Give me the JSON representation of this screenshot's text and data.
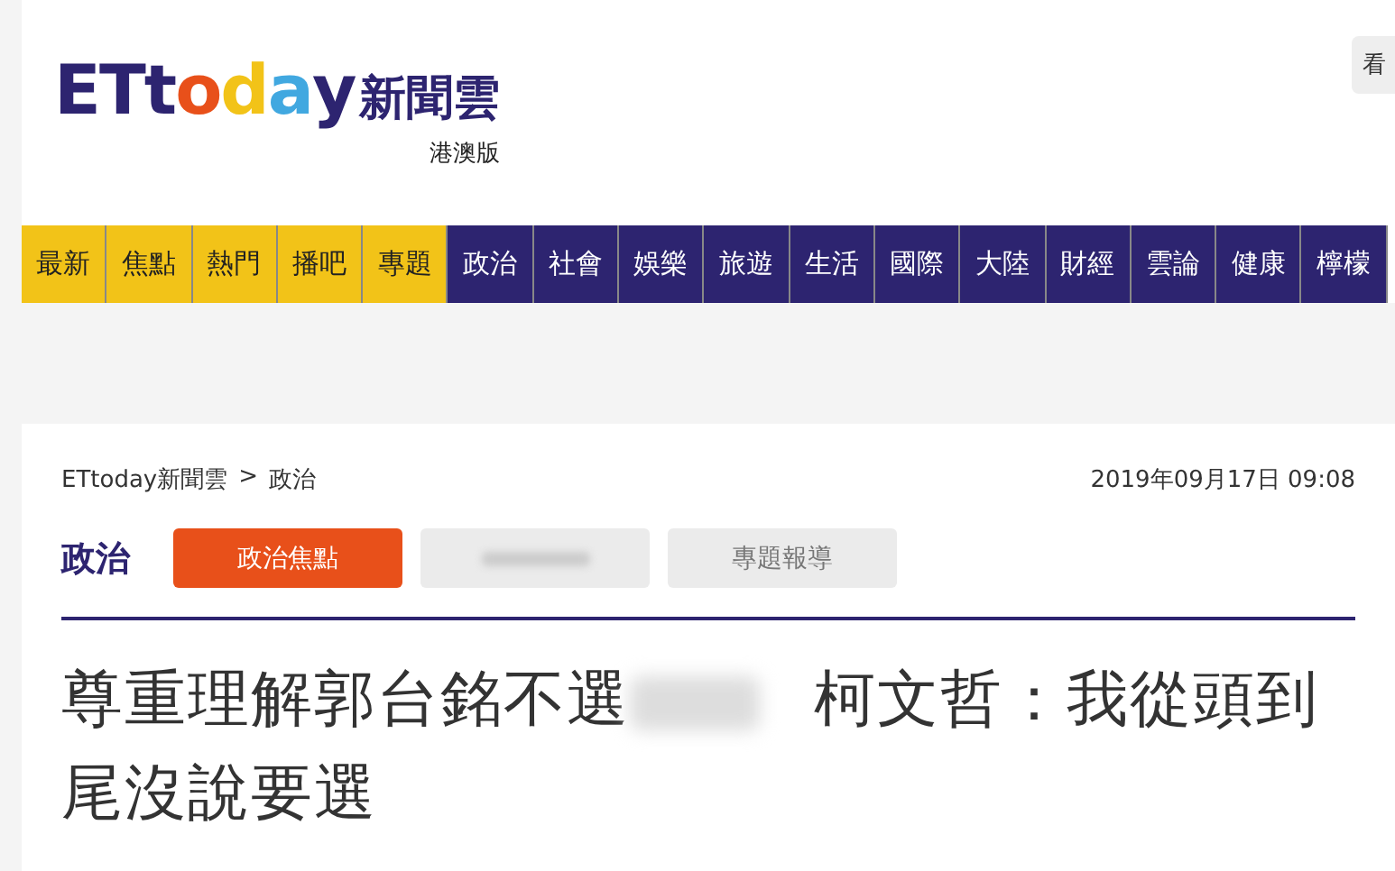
{
  "header": {
    "logo_letters": [
      {
        "text": "E",
        "color": "#2d2470"
      },
      {
        "text": "T",
        "color": "#2d2470"
      },
      {
        "text": "t",
        "color": "#2d2470"
      },
      {
        "text": "o",
        "color": "#e8501a"
      },
      {
        "text": "d",
        "color": "#f2c318"
      },
      {
        "text": "a",
        "color": "#41a8e0"
      },
      {
        "text": "y",
        "color": "#2d2470"
      }
    ],
    "logo_suffix": "新聞雲",
    "edition": "港澳版",
    "corner_button": "看"
  },
  "nav": [
    {
      "label": "最新",
      "color": "#f2c318"
    },
    {
      "label": "焦點",
      "color": "#f2c318"
    },
    {
      "label": "熱門",
      "color": "#f2c318"
    },
    {
      "label": "播吧",
      "color": "#f2c318"
    },
    {
      "label": "專題",
      "color": "#f2c318"
    },
    {
      "label": "政治",
      "color": "#2d2470"
    },
    {
      "label": "社會",
      "color": "#2d2470"
    },
    {
      "label": "娛樂",
      "color": "#2d2470"
    },
    {
      "label": "旅遊",
      "color": "#2d2470"
    },
    {
      "label": "生活",
      "color": "#2d2470"
    },
    {
      "label": "國際",
      "color": "#2d2470"
    },
    {
      "label": "大陸",
      "color": "#2d2470"
    },
    {
      "label": "財經",
      "color": "#2d2470"
    },
    {
      "label": "雲論",
      "color": "#2d2470"
    },
    {
      "label": "健康",
      "color": "#2d2470"
    },
    {
      "label": "檸檬",
      "color": "#2d2470"
    }
  ],
  "breadcrumb": [
    "ETtoday新聞雲",
    "政治"
  ],
  "breadcrumb_separator": ">",
  "date": "2019年09月17日 09:08",
  "section": "政治",
  "tabs": [
    {
      "kind": "text",
      "label": "政治焦點",
      "selected": true
    },
    {
      "kind": "blurred",
      "selected": false
    },
    {
      "kind": "text",
      "label": "專題報導",
      "selected": false
    }
  ],
  "title_parts": [
    {
      "kind": "text",
      "text": "尊重理解郭台銘不選"
    },
    {
      "kind": "blurred"
    },
    {
      "kind": "text",
      "text": "柯文哲：我從頭到尾沒說要選"
    }
  ]
}
